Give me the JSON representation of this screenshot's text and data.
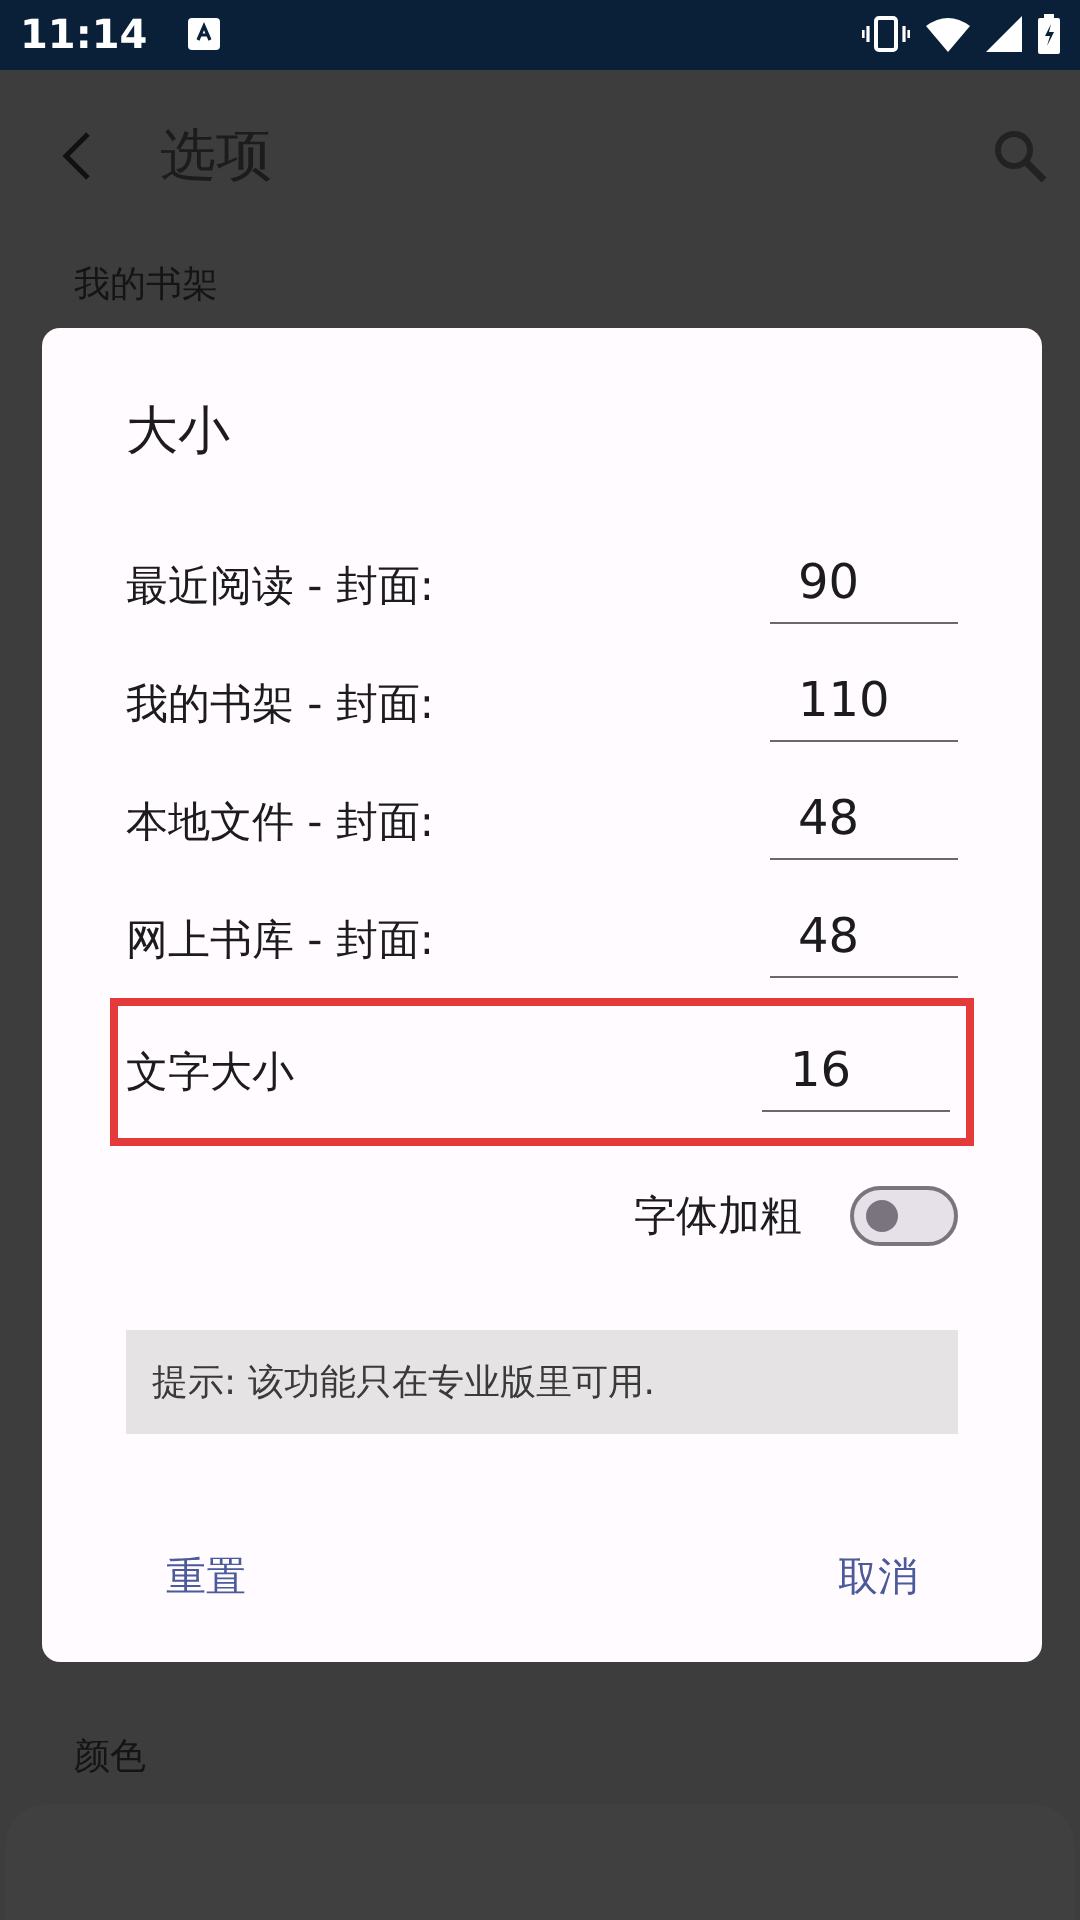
{
  "status_bar": {
    "time": "11:14"
  },
  "app_bar": {
    "title": "选项"
  },
  "sections": [
    {
      "header": "我的书架"
    },
    {
      "header": "颜色"
    }
  ],
  "dialog": {
    "title": "大小",
    "fields": [
      {
        "label": "最近阅读 - 封面:",
        "value": "90",
        "highlighted": false
      },
      {
        "label": "我的书架 - 封面:",
        "value": "110",
        "highlighted": false
      },
      {
        "label": "本地文件 - 封面:",
        "value": "48",
        "highlighted": false
      },
      {
        "label": "网上书库 - 封面:",
        "value": "48",
        "highlighted": false
      },
      {
        "label": "文字大小",
        "value": "16",
        "highlighted": true
      }
    ],
    "bold_toggle": {
      "label": "字体加粗",
      "on": false
    },
    "hint": "提示: 该功能只在专业版里可用.",
    "buttons": [
      "重置",
      "取消"
    ]
  }
}
